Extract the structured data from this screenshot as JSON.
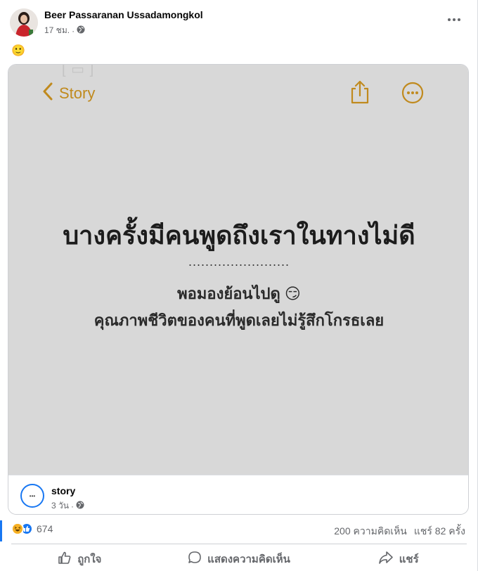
{
  "post": {
    "author": "Beer Passaranan Ussadamongkol",
    "time": "17 ชม.",
    "caption": "🙂"
  },
  "image": {
    "back_label": "Story",
    "headline": "บางครั้งมีคนพูดถึงเราในทางไม่ดี",
    "dots": "........................",
    "line1": "พอมองย้อนไปดู 😏",
    "line2": "คุณภาพชีวิตของคนที่พูดเลยไม่รู้สึกโกรธเลย",
    "accent_color": "#c08a1e"
  },
  "shared": {
    "page_name": "story",
    "time": "3 วัน"
  },
  "stats": {
    "reaction_count": "674",
    "comments": "200 ความคิดเห็น",
    "shares": "แชร์ 82 ครั้ง"
  },
  "actions": {
    "like": "ถูกใจ",
    "comment": "แสดงความคิดเห็น",
    "share": "แชร์"
  }
}
